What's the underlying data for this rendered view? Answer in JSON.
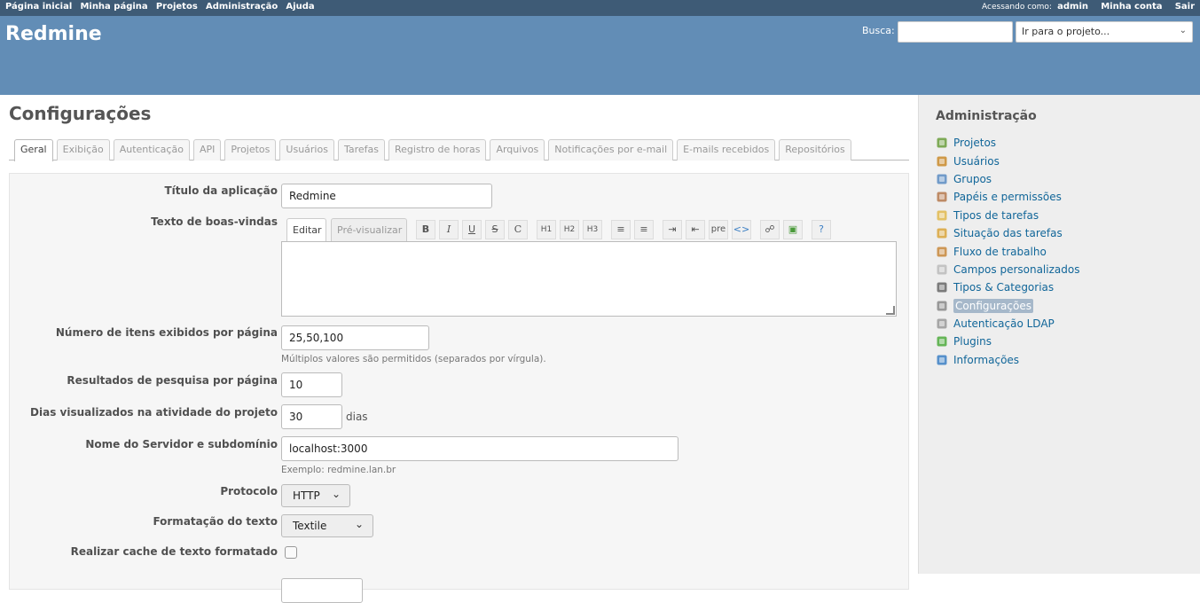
{
  "top_menu": {
    "links": [
      "Página inicial",
      "Minha página",
      "Projetos",
      "Administração",
      "Ajuda"
    ],
    "logged_in_label": "Acessando como:",
    "user": "admin",
    "account": "Minha conta",
    "logout": "Sair"
  },
  "header": {
    "title": "Redmine",
    "search_label": "Busca:",
    "search_value": "",
    "jump_placeholder": "Ir para o projeto..."
  },
  "page": {
    "title": "Configurações"
  },
  "tabs": [
    "Geral",
    "Exibição",
    "Autenticação",
    "API",
    "Projetos",
    "Usuários",
    "Tarefas",
    "Registro de horas",
    "Arquivos",
    "Notificações por e-mail",
    "E-mails recebidos",
    "Repositórios"
  ],
  "form": {
    "app_title": {
      "label": "Título da aplicação",
      "value": "Redmine"
    },
    "welcome_text": {
      "label": "Texto de boas-vindas",
      "edit_tab": "Editar",
      "preview_tab": "Pré-visualizar",
      "toolbar": [
        "B",
        "I",
        "U",
        "S",
        "C",
        "H1",
        "H2",
        "H3",
        "ul",
        "ol",
        "indent",
        "outdent",
        "pre",
        "code",
        "link",
        "image",
        "help"
      ],
      "value": ""
    },
    "per_page": {
      "label": "Número de itens exibidos por página",
      "value": "25,50,100",
      "hint": "Múltiplos valores são permitidos (separados por vírgula)."
    },
    "search_per_page": {
      "label": "Resultados de pesquisa por página",
      "value": "10"
    },
    "activity_days": {
      "label": "Dias visualizados na atividade do projeto",
      "value": "30",
      "suffix": "dias"
    },
    "host_name": {
      "label": "Nome do Servidor e subdomínio",
      "value": "localhost:3000",
      "hint": "Exemplo: redmine.lan.br"
    },
    "protocol": {
      "label": "Protocolo",
      "value": "HTTP"
    },
    "text_formatting": {
      "label": "Formatação do texto",
      "value": "Textile"
    },
    "cache_formatted": {
      "label": "Realizar cache de texto formatado",
      "checked": false
    }
  },
  "sidebar": {
    "title": "Administração",
    "items": [
      {
        "label": "Projetos",
        "icon": "projects-icon",
        "color": "#6a9e3c"
      },
      {
        "label": "Usuários",
        "icon": "user-icon",
        "color": "#c98a2a"
      },
      {
        "label": "Grupos",
        "icon": "group-icon",
        "color": "#5b8cc2"
      },
      {
        "label": "Papéis e permissões",
        "icon": "roles-icon",
        "color": "#b5794d"
      },
      {
        "label": "Tipos de tarefas",
        "icon": "trackers-icon",
        "color": "#e0b84c"
      },
      {
        "label": "Situação das tarefas",
        "icon": "status-icon",
        "color": "#d9a53b"
      },
      {
        "label": "Fluxo de trabalho",
        "icon": "workflow-icon",
        "color": "#c7873b"
      },
      {
        "label": "Campos personalizados",
        "icon": "custom-fields-icon",
        "color": "#bbbbbb"
      },
      {
        "label": "Tipos & Categorias",
        "icon": "list-icon",
        "color": "#666666"
      },
      {
        "label": "Configurações",
        "icon": "settings-icon",
        "color": "#888888",
        "selected": true
      },
      {
        "label": "Autenticação LDAP",
        "icon": "server-key-icon",
        "color": "#999999"
      },
      {
        "label": "Plugins",
        "icon": "plugin-icon",
        "color": "#4caa3c"
      },
      {
        "label": "Informações",
        "icon": "help-icon",
        "color": "#3b7fc4"
      }
    ]
  }
}
